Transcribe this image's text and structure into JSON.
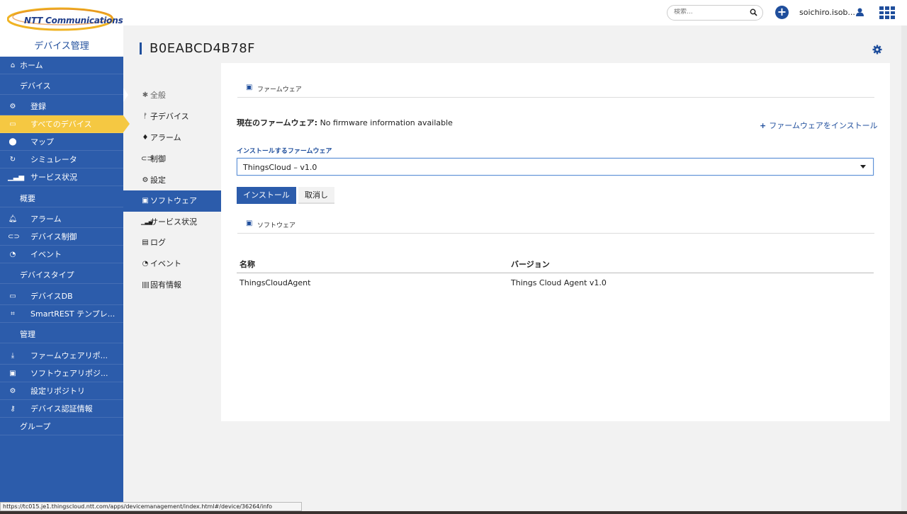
{
  "header": {
    "logo_text": "NTT Communications",
    "app_title": "デバイス管理",
    "search_placeholder": "検索...",
    "username": "soichiro.isob..."
  },
  "sidebar": {
    "items": [
      {
        "label": "ホーム",
        "icon": "home-icon"
      },
      {
        "label": "デバイス",
        "type": "section"
      },
      {
        "label": "登録",
        "icon": "cogs-icon"
      },
      {
        "label": "すべてのデバイス",
        "icon": "inbox-icon",
        "active": true
      },
      {
        "label": "マップ",
        "icon": "map-marker-icon"
      },
      {
        "label": "シミュレータ",
        "icon": "refresh-icon"
      },
      {
        "label": "サービス状況",
        "icon": "signal-icon"
      },
      {
        "label": "概要",
        "type": "section"
      },
      {
        "label": "アラーム",
        "icon": "bell-icon"
      },
      {
        "label": "デバイス制御",
        "icon": "gamepad-icon"
      },
      {
        "label": "イベント",
        "icon": "rss-icon"
      },
      {
        "label": "デバイスタイプ",
        "type": "section"
      },
      {
        "label": "デバイスDB",
        "icon": "hdd-icon"
      },
      {
        "label": "SmartREST テンプレ...",
        "icon": "code-file-icon"
      },
      {
        "label": "管理",
        "type": "section"
      },
      {
        "label": "ファームウェアリポ...",
        "icon": "download-icon"
      },
      {
        "label": "ソフトウェアリポジ...",
        "icon": "save-icon"
      },
      {
        "label": "設定リポジトリ",
        "icon": "cogs-icon"
      },
      {
        "label": "デバイス認証情報",
        "icon": "key-icon"
      },
      {
        "label": "グループ",
        "type": "section"
      }
    ]
  },
  "page": {
    "title": "B0EABCD4B78F"
  },
  "subnav": {
    "items": [
      {
        "label": "全般",
        "icon": "asterisk-icon"
      },
      {
        "label": "子デバイス",
        "icon": "fork-icon"
      },
      {
        "label": "アラーム",
        "icon": "bell-icon"
      },
      {
        "label": "制御",
        "icon": "gamepad-icon"
      },
      {
        "label": "設定",
        "icon": "cogs-icon"
      },
      {
        "label": "ソフトウェア",
        "icon": "save-icon",
        "active": true
      },
      {
        "label": "サービス状況",
        "icon": "signal-icon"
      },
      {
        "label": "ログ",
        "icon": "file-icon"
      },
      {
        "label": "イベント",
        "icon": "rss-icon"
      },
      {
        "label": "固有情報",
        "icon": "barcode-icon"
      }
    ]
  },
  "firmware": {
    "section_title": "ファームウェア",
    "current_label": "現在のファームウェア:",
    "current_value": "No firmware information available",
    "install_link": "ファームウェアをインストール",
    "select_label": "インストールするファームウェア",
    "selected_value": "ThingsCloud – v1.0",
    "install_button": "インストール",
    "cancel_button": "取消し"
  },
  "software": {
    "section_title": "ソフトウェア",
    "columns": [
      "名称",
      "バージョン"
    ],
    "rows": [
      {
        "name": "ThingsCloudAgent",
        "version": "Things Cloud Agent v1.0"
      }
    ]
  },
  "statusbar": {
    "url": "https://tc015.je1.thingscloud.ntt.com/apps/devicemanagement/index.html#/device/36264/info"
  },
  "colors": {
    "primary": "#2c5cab",
    "accent": "#f5c842",
    "link": "#1f4e9c"
  }
}
